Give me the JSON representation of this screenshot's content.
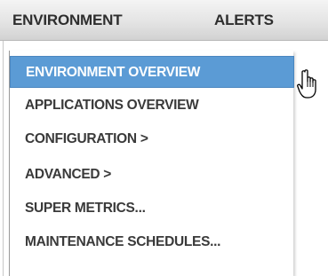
{
  "menubar": {
    "items": [
      {
        "label": "ENVIRONMENT"
      },
      {
        "label": "ALERTS"
      }
    ]
  },
  "dropdown": {
    "items": [
      {
        "label": "ENVIRONMENT OVERVIEW",
        "selected": true
      },
      {
        "label": "APPLICATIONS OVERVIEW",
        "selected": false
      },
      {
        "label": "CONFIGURATION >",
        "selected": false
      },
      {
        "label": "ADVANCED >",
        "selected": false
      },
      {
        "label": "SUPER METRICS...",
        "selected": false
      },
      {
        "label": "MAINTENANCE SCHEDULES...",
        "selected": false
      }
    ]
  },
  "colors": {
    "highlight": "#5b9bd5",
    "text": "#3a3a3a",
    "menubar_text": "#2e2e2e"
  },
  "icons": {
    "cursor": "hand-pointer-icon"
  }
}
